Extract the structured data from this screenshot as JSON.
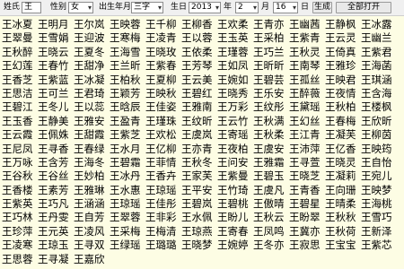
{
  "toolbar": {
    "surname_label": "姓氏",
    "surname_value": "王",
    "gender_label": "性别",
    "gender_value": "女",
    "birth_label": "出生年月",
    "birth_value": "三字",
    "date_label": "生日",
    "year_value": "2013",
    "year_unit": "年",
    "month_value": "2",
    "month_unit": "月",
    "day_value": "16",
    "day_unit": "日",
    "generate_label": "生成",
    "confirm_label": "全部打开"
  },
  "names": [
    [
      "王冰夏",
      "王明月",
      "王尔岚",
      "王映蓉",
      "王千柳",
      "王柳香",
      "王欢柔",
      "王青亦",
      "王幽茜",
      "王静枫"
    ],
    [
      "王冰露",
      "王翠曼",
      "王雪娟",
      "王迎波",
      "王寒梅",
      "王凌青",
      "王以蓉",
      "王玉英",
      "王采柏",
      "王紫青"
    ],
    [
      "王云灵",
      "王幽兰",
      "王秋醉",
      "王晓云",
      "王夏冬",
      "王海雪",
      "王晓玫",
      "王依柔",
      "王瑾蓉",
      "王巧兰"
    ],
    [
      "王秋灵",
      "王倚真",
      "王紫君",
      "王幻莲",
      "王春竹",
      "王甜净",
      "王兰昕",
      "王紫春",
      "王芳琴",
      "王如凤"
    ],
    [
      "王昕昕",
      "王南琴",
      "王雅珍",
      "王海菡",
      "王香芝",
      "王紫蓝",
      "王冰凝",
      "王柏秋",
      "王夏柳",
      "王云美"
    ],
    [
      "王婉如",
      "王碧芸",
      "王孤丝",
      "王映君",
      "王琪涵",
      "王思洁",
      "王可兰",
      "王君琦",
      "王颖芳",
      "王映秋"
    ],
    [
      "王碧红",
      "王晓秀",
      "王乐安",
      "王醉薇",
      "王夜情",
      "王含海",
      "王碧江",
      "王冬儿",
      "王以蕊",
      "王晗辰"
    ],
    [
      "王佳姿",
      "王雅南",
      "王万彩",
      "王纹彤",
      "王黛瑶",
      "王秋柏",
      "王楼枫",
      "王玉香",
      "王静美",
      "王雅安"
    ],
    [
      "王盈青",
      "王瑾珠",
      "王纹昕",
      "王云竹",
      "王秋满",
      "王幻丝",
      "王春梅",
      "王欣昕",
      "王云霞",
      "王佩姝"
    ],
    [
      "王甜霞",
      "王紫芝",
      "王欢松",
      "王虞岚",
      "王寄瑶",
      "王秋柔",
      "王江青",
      "王凝芙",
      "王柳茵",
      "王尼凤"
    ],
    [
      "王寻香",
      "王春绿",
      "王水月",
      "王亿柳",
      "王亦青",
      "王夜柏",
      "王虞安",
      "王沛萍",
      "王亿香",
      "王映筠"
    ],
    [
      "王万咏",
      "王含芳",
      "王海冬",
      "王碧霜",
      "王菲情",
      "王秋冬",
      "王问安",
      "王雅霜",
      "王寻萱",
      "王晓灵"
    ],
    [
      "王自怡",
      "王谷秋",
      "王谷丝",
      "王妙柏",
      "王冰丹",
      "王香卉",
      "王家芙",
      "王紫曼",
      "王碧玉",
      "王晓芝"
    ],
    [
      "王凝莉",
      "王宛儿",
      "王香楼",
      "王素芳",
      "王雅琳",
      "王水惠",
      "王琼瑶",
      "王平安",
      "王竹琦",
      "王虞凡"
    ],
    [
      "王青香",
      "王向珊",
      "王映梦",
      "王紫英",
      "王巧凡",
      "王涵涵",
      "王琼瑶",
      "王佳彤",
      "王碧岚",
      "王碧桃"
    ],
    [
      "王傲晴",
      "王碧星",
      "王晴柔",
      "王海桃",
      "王巧林",
      "王丹雯",
      "王自芳",
      "王翠蓉",
      "王非彩",
      "王水佩"
    ],
    [
      "王盼儿",
      "王秋云",
      "王盼翠",
      "王秋秋",
      "王雪巧",
      "王珍萍",
      "王元英",
      "王凌风",
      "王采梅",
      "王梅清"
    ],
    [
      "王琼燕",
      "王寄春",
      "王凤鸣",
      "王冀亦",
      "王秋荷",
      "王新泽",
      "王凌寒",
      "王琼玉",
      "王寻双",
      "王绿瑶"
    ],
    [
      "王璐璐",
      "王晓梦",
      "王婉婷",
      "王冬亦",
      "王寂思",
      "王宝宝",
      "王紫芯",
      "王思蓉",
      "王寻凝",
      "王嘉欣"
    ]
  ]
}
